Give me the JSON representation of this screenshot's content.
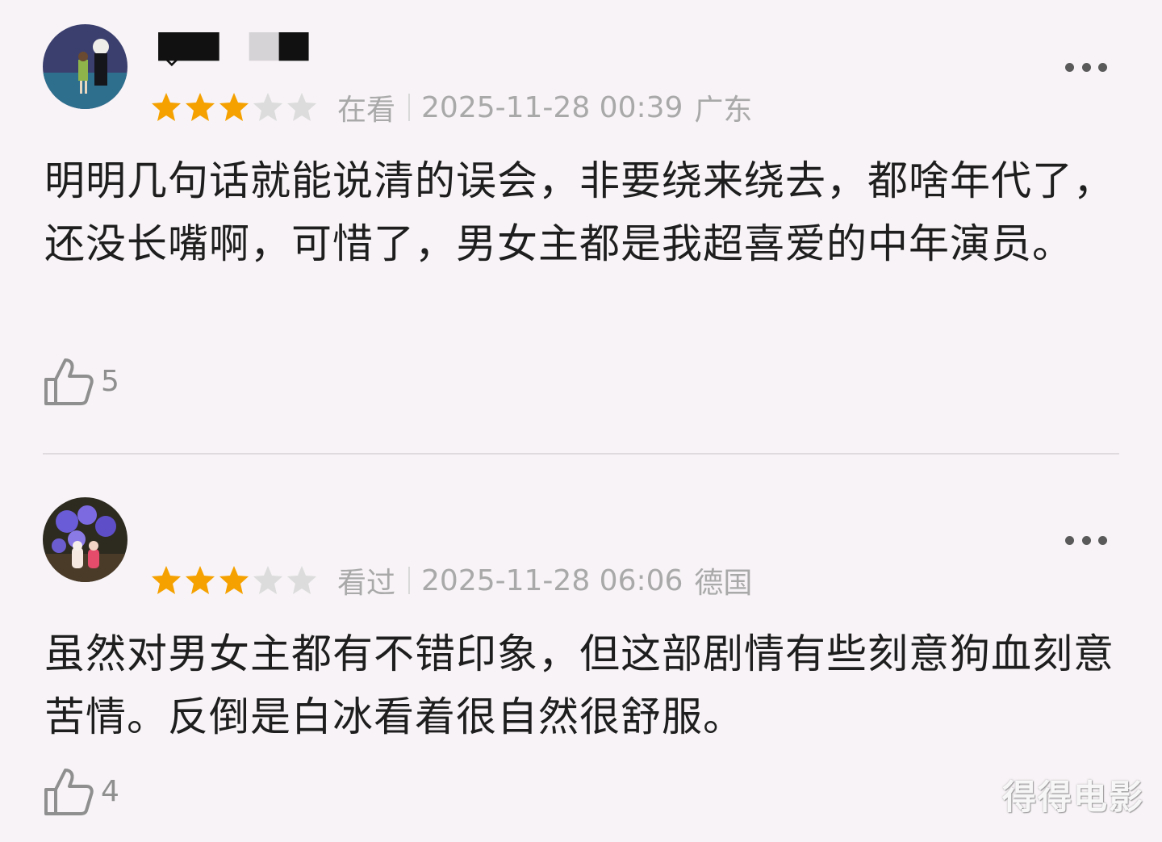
{
  "comments": [
    {
      "rating": 3,
      "max_rating": 5,
      "status": "在看",
      "timestamp": "2025-11-28 00:39",
      "location": "广东",
      "text": "明明几句话就能说清的误会，非要绕来绕去，都啥年代了，还没长嘴啊，可惜了，男女主都是我超喜爱的中年演员。",
      "likes": "5"
    },
    {
      "rating": 3,
      "max_rating": 5,
      "status": "看过",
      "timestamp": "2025-11-28 06:06",
      "location": "德国",
      "text": "虽然对男女主都有不错印象，但这部剧情有些刻意狗血刻意苦情。反倒是白冰看着很自然很舒服。",
      "likes": "4"
    }
  ],
  "icons": {
    "more": "more-horizontal-icon",
    "like": "thumbs-up-icon",
    "star": "star-icon"
  },
  "colors": {
    "background": "#f7f3f6",
    "star_filled": "#f5a100",
    "star_empty": "#dcdcdc",
    "meta_text": "#a9a9a9",
    "body_text": "#1e1e1e"
  },
  "watermark": "得得电影"
}
